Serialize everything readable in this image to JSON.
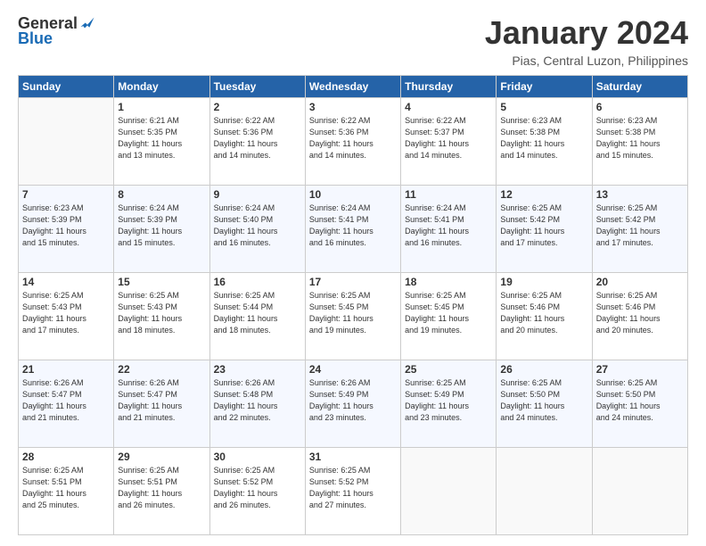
{
  "logo": {
    "general": "General",
    "blue": "Blue"
  },
  "header": {
    "month": "January 2024",
    "location": "Pias, Central Luzon, Philippines"
  },
  "days_of_week": [
    "Sunday",
    "Monday",
    "Tuesday",
    "Wednesday",
    "Thursday",
    "Friday",
    "Saturday"
  ],
  "weeks": [
    [
      {
        "day": "",
        "info": ""
      },
      {
        "day": "1",
        "info": "Sunrise: 6:21 AM\nSunset: 5:35 PM\nDaylight: 11 hours\nand 13 minutes."
      },
      {
        "day": "2",
        "info": "Sunrise: 6:22 AM\nSunset: 5:36 PM\nDaylight: 11 hours\nand 14 minutes."
      },
      {
        "day": "3",
        "info": "Sunrise: 6:22 AM\nSunset: 5:36 PM\nDaylight: 11 hours\nand 14 minutes."
      },
      {
        "day": "4",
        "info": "Sunrise: 6:22 AM\nSunset: 5:37 PM\nDaylight: 11 hours\nand 14 minutes."
      },
      {
        "day": "5",
        "info": "Sunrise: 6:23 AM\nSunset: 5:38 PM\nDaylight: 11 hours\nand 14 minutes."
      },
      {
        "day": "6",
        "info": "Sunrise: 6:23 AM\nSunset: 5:38 PM\nDaylight: 11 hours\nand 15 minutes."
      }
    ],
    [
      {
        "day": "7",
        "info": "Sunrise: 6:23 AM\nSunset: 5:39 PM\nDaylight: 11 hours\nand 15 minutes."
      },
      {
        "day": "8",
        "info": "Sunrise: 6:24 AM\nSunset: 5:39 PM\nDaylight: 11 hours\nand 15 minutes."
      },
      {
        "day": "9",
        "info": "Sunrise: 6:24 AM\nSunset: 5:40 PM\nDaylight: 11 hours\nand 16 minutes."
      },
      {
        "day": "10",
        "info": "Sunrise: 6:24 AM\nSunset: 5:41 PM\nDaylight: 11 hours\nand 16 minutes."
      },
      {
        "day": "11",
        "info": "Sunrise: 6:24 AM\nSunset: 5:41 PM\nDaylight: 11 hours\nand 16 minutes."
      },
      {
        "day": "12",
        "info": "Sunrise: 6:25 AM\nSunset: 5:42 PM\nDaylight: 11 hours\nand 17 minutes."
      },
      {
        "day": "13",
        "info": "Sunrise: 6:25 AM\nSunset: 5:42 PM\nDaylight: 11 hours\nand 17 minutes."
      }
    ],
    [
      {
        "day": "14",
        "info": "Sunrise: 6:25 AM\nSunset: 5:43 PM\nDaylight: 11 hours\nand 17 minutes."
      },
      {
        "day": "15",
        "info": "Sunrise: 6:25 AM\nSunset: 5:43 PM\nDaylight: 11 hours\nand 18 minutes."
      },
      {
        "day": "16",
        "info": "Sunrise: 6:25 AM\nSunset: 5:44 PM\nDaylight: 11 hours\nand 18 minutes."
      },
      {
        "day": "17",
        "info": "Sunrise: 6:25 AM\nSunset: 5:45 PM\nDaylight: 11 hours\nand 19 minutes."
      },
      {
        "day": "18",
        "info": "Sunrise: 6:25 AM\nSunset: 5:45 PM\nDaylight: 11 hours\nand 19 minutes."
      },
      {
        "day": "19",
        "info": "Sunrise: 6:25 AM\nSunset: 5:46 PM\nDaylight: 11 hours\nand 20 minutes."
      },
      {
        "day": "20",
        "info": "Sunrise: 6:25 AM\nSunset: 5:46 PM\nDaylight: 11 hours\nand 20 minutes."
      }
    ],
    [
      {
        "day": "21",
        "info": "Sunrise: 6:26 AM\nSunset: 5:47 PM\nDaylight: 11 hours\nand 21 minutes."
      },
      {
        "day": "22",
        "info": "Sunrise: 6:26 AM\nSunset: 5:47 PM\nDaylight: 11 hours\nand 21 minutes."
      },
      {
        "day": "23",
        "info": "Sunrise: 6:26 AM\nSunset: 5:48 PM\nDaylight: 11 hours\nand 22 minutes."
      },
      {
        "day": "24",
        "info": "Sunrise: 6:26 AM\nSunset: 5:49 PM\nDaylight: 11 hours\nand 23 minutes."
      },
      {
        "day": "25",
        "info": "Sunrise: 6:25 AM\nSunset: 5:49 PM\nDaylight: 11 hours\nand 23 minutes."
      },
      {
        "day": "26",
        "info": "Sunrise: 6:25 AM\nSunset: 5:50 PM\nDaylight: 11 hours\nand 24 minutes."
      },
      {
        "day": "27",
        "info": "Sunrise: 6:25 AM\nSunset: 5:50 PM\nDaylight: 11 hours\nand 24 minutes."
      }
    ],
    [
      {
        "day": "28",
        "info": "Sunrise: 6:25 AM\nSunset: 5:51 PM\nDaylight: 11 hours\nand 25 minutes."
      },
      {
        "day": "29",
        "info": "Sunrise: 6:25 AM\nSunset: 5:51 PM\nDaylight: 11 hours\nand 26 minutes."
      },
      {
        "day": "30",
        "info": "Sunrise: 6:25 AM\nSunset: 5:52 PM\nDaylight: 11 hours\nand 26 minutes."
      },
      {
        "day": "31",
        "info": "Sunrise: 6:25 AM\nSunset: 5:52 PM\nDaylight: 11 hours\nand 27 minutes."
      },
      {
        "day": "",
        "info": ""
      },
      {
        "day": "",
        "info": ""
      },
      {
        "day": "",
        "info": ""
      }
    ]
  ]
}
